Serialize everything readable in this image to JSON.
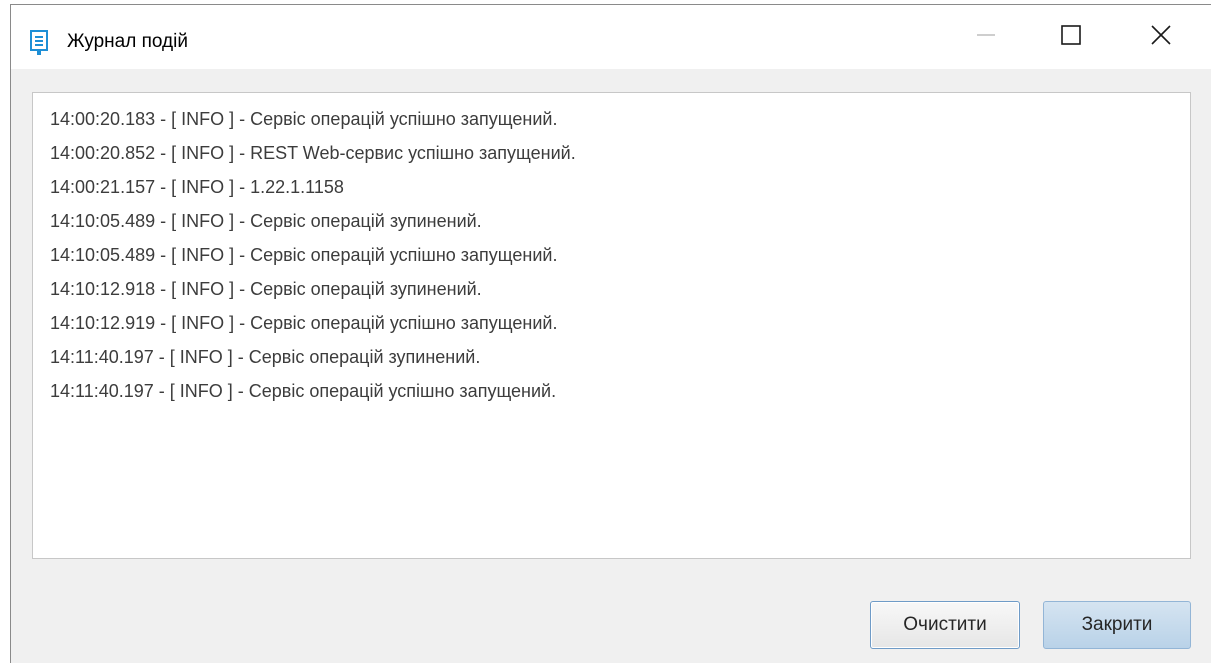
{
  "window": {
    "title": "Журнал подій",
    "icon": "log-document-icon",
    "controls": {
      "minimize_icon": "minimize-icon",
      "maximize_icon": "maximize-icon",
      "close_icon": "close-icon"
    }
  },
  "log": {
    "lines": [
      "14:00:20.183 - [ INFO ] - Сервіс операцій успішно запущений.",
      "14:00:20.852 - [ INFO ] - REST Web-сервис успішно запущений.",
      "14:00:21.157 - [ INFO ] - 1.22.1.1158",
      "14:10:05.489 - [ INFO ] - Сервіс операцій зупинений.",
      "14:10:05.489 - [ INFO ] - Сервіс операцій успішно запущений.",
      "14:10:12.918 - [ INFO ] - Сервіс операцій зупинений.",
      "14:10:12.919 - [ INFO ] - Сервіс операцій успішно запущений.",
      "14:11:40.197 - [ INFO ] - Сервіс операцій зупинений.",
      "14:11:40.197 - [ INFO ] - Сервіс операцій успішно запущений."
    ]
  },
  "buttons": {
    "clear_label": "Очистити",
    "close_label": "Закрити"
  },
  "colors": {
    "accent": "#1e8fd6",
    "default_button_border": "#6f9bc7",
    "highlighted_button_bg": "#c4d9ec"
  }
}
